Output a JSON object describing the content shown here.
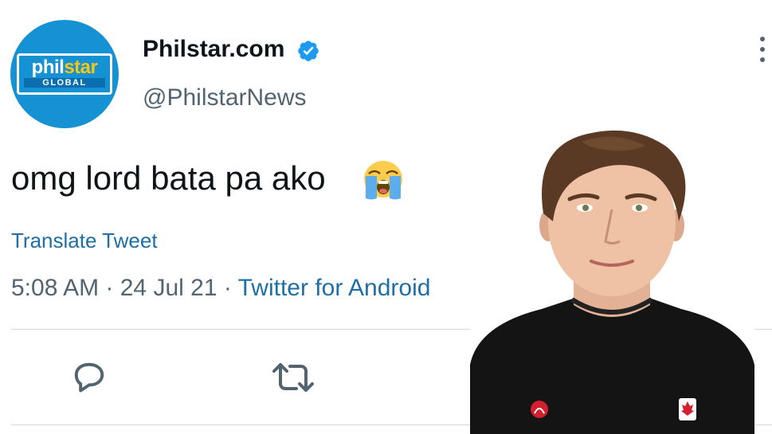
{
  "account": {
    "display_name": "Philstar.com",
    "handle": "@PhilstarNews",
    "avatar": {
      "brand_part1": "phil",
      "brand_part2": "star",
      "brand_sub": "GLOBAL",
      "background_color": "#1592d3"
    },
    "verified_icon": "verified-badge-icon"
  },
  "more_icon": "kebab-menu-icon",
  "tweet": {
    "text": "omg lord bata pa ako",
    "emoji_icon": "loudly-crying-face-icon",
    "translate_label": "Translate Tweet",
    "time": "5:08 AM",
    "separator": " · ",
    "date": "24 Jul 21",
    "source": "Twitter for Android"
  },
  "actions": {
    "reply_icon": "reply-bubble-icon",
    "retweet_icon": "retweet-icon"
  },
  "photo": {
    "shirt_logos": [
      "lululemon-logo",
      "canada-maple-leaf-logo"
    ]
  },
  "colors": {
    "text_primary": "#0f1419",
    "text_secondary": "#536471",
    "link": "#1d6fa5",
    "verified": "#1d9bf0",
    "divider": "#cfd9de"
  }
}
